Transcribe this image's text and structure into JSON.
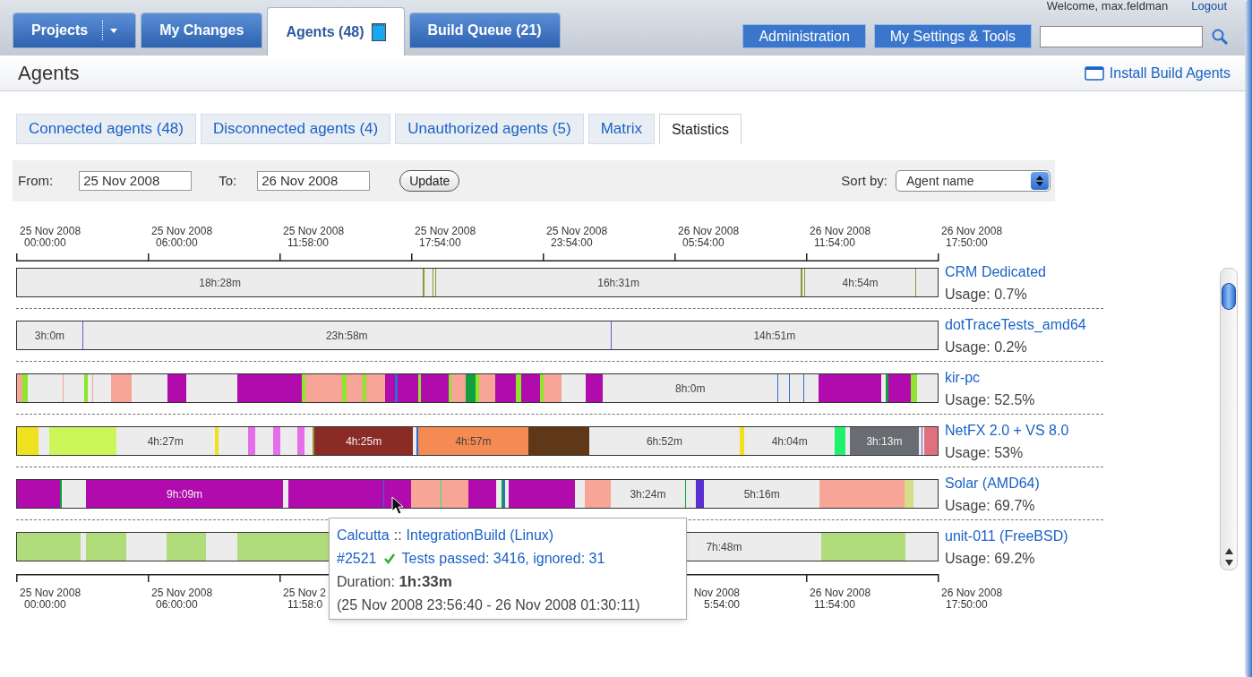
{
  "header": {
    "tabs": [
      {
        "label": "Projects",
        "selected": false,
        "kind": "dropdown"
      },
      {
        "label": "My Changes",
        "selected": false,
        "kind": "plain"
      },
      {
        "label": "Agents (48)",
        "selected": true,
        "kind": "agents"
      },
      {
        "label": "Build Queue (21)",
        "selected": false,
        "kind": "plain"
      }
    ],
    "welcome": "Welcome, max.feldman",
    "logout": "Logout",
    "buttons": [
      "Administration",
      "My Settings & Tools"
    ]
  },
  "page": {
    "title": "Agents",
    "install_link": "Install Build Agents"
  },
  "subtabs": [
    {
      "label": "Connected agents (48)",
      "selected": false
    },
    {
      "label": "Disconnected agents (4)",
      "selected": false
    },
    {
      "label": "Unauthorized agents (5)",
      "selected": false
    },
    {
      "label": "Matrix",
      "selected": false
    },
    {
      "label": "Statistics",
      "selected": true
    }
  ],
  "filter": {
    "from_label": "From:",
    "from_value": "25 Nov 2008",
    "to_label": "To:",
    "to_value": "26 Nov 2008",
    "update": "Update",
    "sort_label": "Sort by:",
    "sort_value": "Agent name"
  },
  "axis_top": [
    {
      "date": "25 Nov 2008",
      "time": "00:00:00",
      "kind": "full"
    },
    {
      "date": "25 Nov 2008",
      "time": "06:00:00",
      "kind": "full"
    },
    {
      "date": "25 Nov 2008",
      "time": "11:58:00",
      "kind": "full"
    },
    {
      "date": "25 Nov 2008",
      "time": "17:54:00",
      "kind": "full"
    },
    {
      "date": "25 Nov 2008",
      "time": "23:54:00",
      "kind": "full"
    },
    {
      "date": "26 Nov 2008",
      "time": "05:54:00",
      "kind": "full"
    },
    {
      "date": "26 Nov 2008",
      "time": "11:54:00",
      "kind": "full"
    },
    {
      "date": "26 Nov 2008",
      "time": "17:50:00",
      "kind": "full"
    }
  ],
  "agents": [
    {
      "name": "CRM Dedicated",
      "usage": "Usage: 0.7%",
      "segments": [
        {
          "kind": "idle",
          "label": "18h:28m"
        },
        {
          "kind": "busy",
          "color": "#8a9a3a"
        },
        {
          "kind": "idle"
        },
        {
          "kind": "busy",
          "color": "#8a9a3a"
        },
        {
          "kind": "idle"
        },
        {
          "kind": "busy",
          "color": "#8a9a3a"
        },
        {
          "kind": "idle",
          "label": "16h:31m"
        },
        {
          "kind": "busy",
          "color": "#8a9a3a"
        },
        {
          "kind": "idle"
        },
        {
          "kind": "busy",
          "color": "#8a9a3a"
        },
        {
          "kind": "idle",
          "label": "4h:54m"
        },
        {
          "kind": "busy",
          "color": "#8a9a3a"
        },
        {
          "kind": "idle"
        }
      ]
    },
    {
      "name": "dotTraceTests_amd64",
      "usage": "Usage: 0.2%",
      "segments": [
        {
          "kind": "idle",
          "label": "3h:0m"
        },
        {
          "kind": "busy",
          "color": "#7b4fd6"
        },
        {
          "kind": "idle",
          "label": "23h:58m"
        },
        {
          "kind": "busy",
          "color": "#7b4fd6"
        },
        {
          "kind": "idle",
          "label": "14h:51m"
        }
      ]
    },
    {
      "name": "kir-pc",
      "usage": "Usage: 52.5%",
      "segments": [
        {
          "kind": "busy",
          "color": "#f6a596"
        },
        {
          "kind": "busy",
          "color": "#8ee62c"
        },
        {
          "kind": "idle"
        },
        {
          "kind": "busy",
          "color": "#f6a596"
        },
        {
          "kind": "idle"
        },
        {
          "kind": "busy",
          "color": "#8ee62c"
        },
        {
          "kind": "idle"
        },
        {
          "kind": "busy",
          "color": "#f6a596"
        },
        {
          "kind": "idle"
        },
        {
          "kind": "busy",
          "color": "#f6a596"
        },
        {
          "kind": "idle"
        },
        {
          "kind": "busy",
          "color": "#b10aad"
        },
        {
          "kind": "idle"
        },
        {
          "kind": "busy",
          "color": "#b10aad"
        },
        {
          "kind": "busy",
          "color": "#8ee62c"
        },
        {
          "kind": "busy",
          "color": "#f6a596"
        },
        {
          "kind": "busy",
          "color": "#8ee62c"
        },
        {
          "kind": "busy",
          "color": "#f6a596"
        },
        {
          "kind": "busy",
          "color": "#8ee62c"
        },
        {
          "kind": "busy",
          "color": "#f6a596"
        },
        {
          "kind": "busy",
          "color": "#b10aad"
        },
        {
          "kind": "busy",
          "color": "#2d6fd0"
        },
        {
          "kind": "busy",
          "color": "#b10aad"
        },
        {
          "kind": "busy",
          "color": "#8ee62c"
        },
        {
          "kind": "busy",
          "color": "#b10aad"
        },
        {
          "kind": "busy",
          "color": "#8ee62c"
        },
        {
          "kind": "busy",
          "color": "#f6a596"
        },
        {
          "kind": "busy",
          "color": "#10a040"
        },
        {
          "kind": "busy",
          "color": "#8ee62c"
        },
        {
          "kind": "busy",
          "color": "#f6a596"
        },
        {
          "kind": "busy",
          "color": "#b10aad"
        },
        {
          "kind": "busy",
          "color": "#8ee62c"
        },
        {
          "kind": "busy",
          "color": "#b10aad"
        },
        {
          "kind": "busy",
          "color": "#8ee62c"
        },
        {
          "kind": "busy",
          "color": "#f6a596"
        },
        {
          "kind": "idle"
        },
        {
          "kind": "busy",
          "color": "#b10aad"
        },
        {
          "kind": "idle",
          "label": "8h:0m"
        },
        {
          "kind": "busy",
          "color": "#2d6fd0"
        },
        {
          "kind": "idle"
        },
        {
          "kind": "busy",
          "color": "#2d6fd0"
        },
        {
          "kind": "idle"
        },
        {
          "kind": "busy",
          "color": "#2d6fd0"
        },
        {
          "kind": "idle"
        },
        {
          "kind": "busy",
          "color": "#b10aad"
        },
        {
          "kind": "idle"
        },
        {
          "kind": "busy",
          "color": "#10a040"
        },
        {
          "kind": "busy",
          "color": "#b10aad"
        },
        {
          "kind": "busy",
          "color": "#8ee62c"
        },
        {
          "kind": "idle"
        }
      ]
    },
    {
      "name": "NetFX 2.0 + VS 8.0",
      "usage": "Usage: 53%",
      "segments": [
        {
          "kind": "busy",
          "color": "#f0e11f"
        },
        {
          "kind": "idle"
        },
        {
          "kind": "busy",
          "color": "#ccf55a"
        },
        {
          "kind": "idle",
          "label": "4h:27m"
        },
        {
          "kind": "busy",
          "color": "#f0e11f"
        },
        {
          "kind": "idle"
        },
        {
          "kind": "busy",
          "color": "#e36ee8"
        },
        {
          "kind": "idle"
        },
        {
          "kind": "busy",
          "color": "#e36ee8"
        },
        {
          "kind": "idle"
        },
        {
          "kind": "busy",
          "color": "#e36ee8"
        },
        {
          "kind": "idle"
        },
        {
          "kind": "busy",
          "color": "#8a9a3a"
        },
        {
          "kind": "busy",
          "color": "#8b2b25",
          "label": "4h:25m"
        },
        {
          "kind": "idle"
        },
        {
          "kind": "busy",
          "color": "#2d6fd0"
        },
        {
          "kind": "busy",
          "color": "#f58a52",
          "label": "4h:57m"
        },
        {
          "kind": "busy",
          "color": "#5e3818"
        },
        {
          "kind": "idle",
          "label": "6h:52m"
        },
        {
          "kind": "busy",
          "color": "#f0e11f"
        },
        {
          "kind": "idle",
          "label": "4h:04m"
        },
        {
          "kind": "busy",
          "color": "#1ef26a"
        },
        {
          "kind": "idle"
        },
        {
          "kind": "busy",
          "color": "#696d72",
          "label": "3h:13m"
        },
        {
          "kind": "idle"
        },
        {
          "kind": "busy",
          "color": "#7b4fd6"
        },
        {
          "kind": "idle"
        },
        {
          "kind": "busy",
          "color": "#e07080"
        }
      ]
    },
    {
      "name": "Solar (AMD64)",
      "usage": "Usage: 69.7%",
      "segments": [
        {
          "kind": "busy",
          "color": "#b10aad"
        },
        {
          "kind": "busy",
          "color": "#10a040"
        },
        {
          "kind": "idle"
        },
        {
          "kind": "busy",
          "color": "#b10aad",
          "label": "9h:09m"
        },
        {
          "kind": "idle"
        },
        {
          "kind": "busy",
          "color": "#b10aad"
        },
        {
          "kind": "busy",
          "color": "#2d6fd0"
        },
        {
          "kind": "busy",
          "color": "#b10aad"
        },
        {
          "kind": "busy",
          "color": "#f6a596"
        },
        {
          "kind": "busy",
          "color": "#1ef26a"
        },
        {
          "kind": "busy",
          "color": "#f6a596"
        },
        {
          "kind": "busy",
          "color": "#b10aad"
        },
        {
          "kind": "idle"
        },
        {
          "kind": "busy",
          "color": "#10a040"
        },
        {
          "kind": "busy",
          "color": "#2d6fd0"
        },
        {
          "kind": "idle"
        },
        {
          "kind": "busy",
          "color": "#b10aad"
        },
        {
          "kind": "idle"
        },
        {
          "kind": "busy",
          "color": "#f6a596"
        },
        {
          "kind": "idle",
          "label": "3h:24m"
        },
        {
          "kind": "busy",
          "color": "#10a040"
        },
        {
          "kind": "idle"
        },
        {
          "kind": "busy",
          "color": "#5a2fd0"
        },
        {
          "kind": "idle",
          "label": "5h:16m"
        },
        {
          "kind": "busy",
          "color": "#f6a596"
        },
        {
          "kind": "busy",
          "color": "#d6dc8a"
        },
        {
          "kind": "idle"
        }
      ]
    },
    {
      "name": "unit-011 (FreeBSD)",
      "usage": "Usage: 69.2%",
      "segments": [
        {
          "kind": "busy",
          "color": "#b0dc7c"
        },
        {
          "kind": "idle"
        },
        {
          "kind": "busy",
          "color": "#b0dc7c"
        },
        {
          "kind": "idle"
        },
        {
          "kind": "busy",
          "color": "#b0dc7c"
        },
        {
          "kind": "idle"
        },
        {
          "kind": "busy",
          "color": "#b0dc7c"
        },
        {
          "kind": "idle"
        },
        {
          "kind": "idle",
          "label": "7h:48m"
        },
        {
          "kind": "busy",
          "color": "#b0dc7c"
        },
        {
          "kind": "idle"
        }
      ]
    }
  ],
  "axis_bottom": [
    {
      "date": "25 Nov 2008",
      "time": "00:00:00",
      "kind": "full"
    },
    {
      "date": "25 Nov 2008",
      "time": "06:00:00",
      "kind": "full"
    },
    {
      "date": "25 Nov 2",
      "time": "11:58:0",
      "kind": "cut_right"
    },
    {
      "date": "Nov 2008",
      "time": "5:54:00",
      "kind": "cut_left"
    },
    {
      "date": "26 Nov 2008",
      "time": "11:54:00",
      "kind": "full"
    },
    {
      "date": "26 Nov 2008",
      "time": "17:50:00",
      "kind": "full"
    }
  ],
  "tooltip": {
    "project": "Calcutta",
    "separator": "::",
    "build_type": "IntegrationBuild (Linux)",
    "build_number": "#2521",
    "status": "Tests passed: 3416, ignored: 31",
    "duration": "Duration: **1h:33m**",
    "period": "(25 Nov 2008 23:56:40 - 26 Nov 2008 01:30:11)"
  }
}
